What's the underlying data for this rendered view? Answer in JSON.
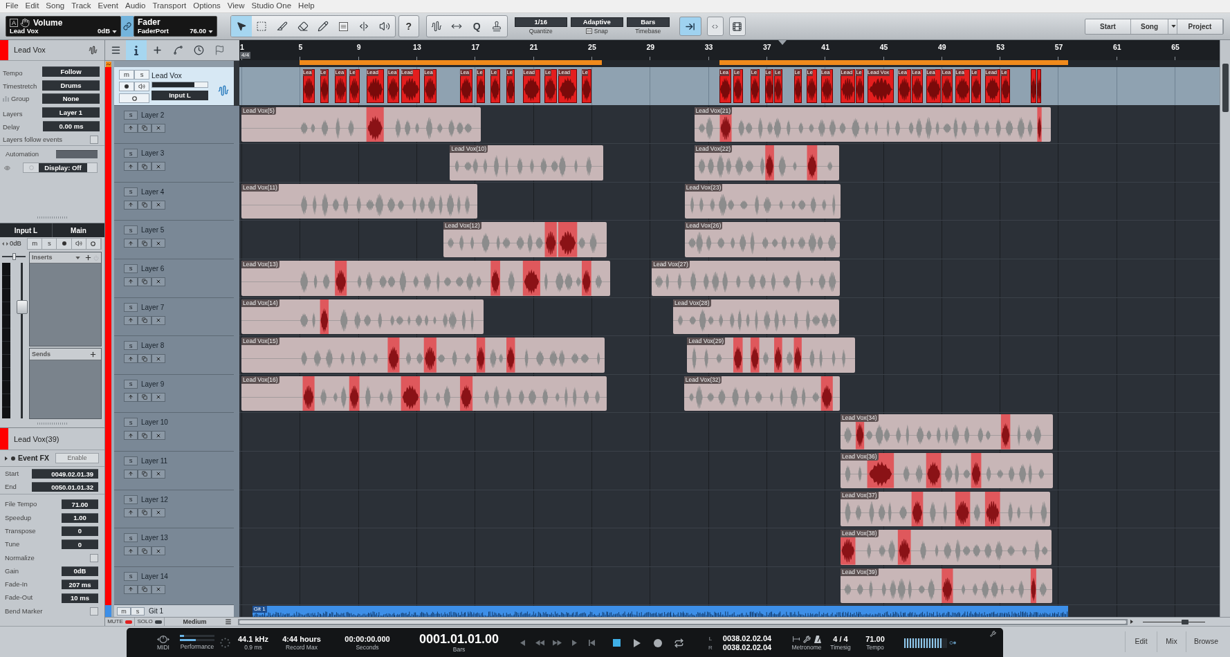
{
  "menu": [
    "File",
    "Edit",
    "Song",
    "Track",
    "Event",
    "Audio",
    "Transport",
    "Options",
    "View",
    "Studio One",
    "Help"
  ],
  "toolbar": {
    "volume": {
      "badge": "A",
      "title": "Volume",
      "track": "Lead Vox",
      "value": "0dB"
    },
    "link": {
      "on": true
    },
    "fader": {
      "title": "Fader",
      "device": "FaderPort",
      "value": "76.00"
    },
    "tools": [
      {
        "kind": "arrow",
        "selected": true
      },
      {
        "kind": "range",
        "selected": false
      },
      {
        "kind": "split",
        "selected": false
      },
      {
        "kind": "eraser",
        "selected": false
      },
      {
        "kind": "paint",
        "selected": false
      },
      {
        "kind": "mute",
        "selected": false
      },
      {
        "kind": "bend",
        "selected": false
      },
      {
        "kind": "listen",
        "selected": false
      }
    ],
    "help": "?",
    "edit_tools": [
      {
        "kind": "quantize"
      },
      {
        "kind": "stretch"
      },
      {
        "kind": "letter",
        "label": "Q"
      },
      {
        "kind": "stamp"
      }
    ],
    "quantize": {
      "value": "1/16",
      "label": "Quantize"
    },
    "snap": {
      "value": "Adaptive",
      "label": "Snap"
    },
    "timebase": {
      "value": "Bars",
      "label": "Timebase"
    },
    "toggles": [
      {
        "kind": "autoscroll",
        "on": true
      },
      {
        "kind": "follow",
        "on": false
      },
      {
        "kind": "video",
        "on": false
      }
    ],
    "pages": [
      {
        "label": "Start"
      },
      {
        "label": "Song",
        "kind": "dropdown"
      },
      {
        "label": "Project"
      }
    ]
  },
  "inspector": {
    "track": {
      "name": "Lead Vox",
      "color": "#ff0000"
    },
    "settings": [
      {
        "kind": "button",
        "label": "Tempo",
        "value": "Follow"
      },
      {
        "kind": "button",
        "label": "Timestretch",
        "value": "Drums"
      },
      {
        "kind": "group",
        "label": "Group",
        "value": "None"
      },
      {
        "kind": "button",
        "label": "Layers",
        "value": "Layer 1"
      },
      {
        "kind": "field",
        "label": "Delay",
        "value": "0.00 ms"
      },
      {
        "kind": "checkbox",
        "label": "Layers follow events",
        "checked": false
      }
    ],
    "automation": {
      "label": "Automation",
      "display": "Display: Off"
    },
    "channel": {
      "input": "Input L",
      "output": "Main",
      "volume": "0dB",
      "buttons": [
        {
          "kind": "letter",
          "label": "m"
        },
        {
          "kind": "letter",
          "label": "s"
        },
        {
          "kind": "record"
        },
        {
          "kind": "monitor"
        },
        {
          "kind": "ring"
        }
      ],
      "pan": {
        "level": 0.5
      },
      "fader": {
        "level": 0.75
      },
      "inserts": "Inserts",
      "sends": "Sends"
    },
    "event": {
      "name": "Lead Vox(39)",
      "color": "#ff0000",
      "fx": "Event FX",
      "enable": "Enable",
      "range": [
        {
          "label": "Start",
          "value": "0049.02.01.39"
        },
        {
          "label": "End",
          "value": "0050.01.01.32"
        }
      ],
      "properties": [
        {
          "kind": "field",
          "label": "File Tempo",
          "value": "71.00"
        },
        {
          "kind": "field",
          "label": "Speedup",
          "value": "1.00"
        },
        {
          "kind": "field",
          "label": "Transpose",
          "value": "0"
        },
        {
          "kind": "field",
          "label": "Tune",
          "value": "0"
        },
        {
          "kind": "checkbox",
          "label": "Normalize",
          "checked": false
        },
        {
          "kind": "field",
          "label": "Gain",
          "value": "0dB"
        },
        {
          "kind": "field",
          "label": "Fade-In",
          "value": "207 ms"
        },
        {
          "kind": "field",
          "label": "Fade-Out",
          "value": "10 ms"
        },
        {
          "kind": "checkbox",
          "label": "Bend Marker",
          "checked": false
        }
      ]
    }
  },
  "tracklist_tabs": [
    {
      "kind": "list",
      "selected": false
    },
    {
      "kind": "info",
      "selected": true
    },
    {
      "kind": "add",
      "selected": false
    },
    {
      "kind": "automation",
      "selected": false
    },
    {
      "kind": "tempo",
      "selected": false
    },
    {
      "kind": "marker",
      "selected": false
    }
  ],
  "arrangement": {
    "ruler": {
      "time_signature": "4/4",
      "bars": [
        "1",
        "5",
        "9",
        "13",
        "17",
        "21",
        "25",
        "29",
        "33",
        "37",
        "41",
        "45",
        "49",
        "53",
        "57",
        "61",
        "65"
      ]
    }
  },
  "tracks": [
    {
      "kind": "main",
      "name": "Lead Vox",
      "color": "#ff0000",
      "buttons": [
        {
          "kind": "letter",
          "label": "m"
        },
        {
          "kind": "letter",
          "label": "s"
        },
        {
          "kind": "record"
        },
        {
          "kind": "monitor"
        },
        {
          "kind": "ring"
        }
      ],
      "level": 0.76,
      "input": "Input L",
      "segments": [
        "Lea",
        "Le",
        "Lea",
        "Le",
        "Lead",
        "Lea",
        "Lead",
        "Lea",
        "Lea",
        "Le",
        "Le",
        "Le",
        "Lead",
        "Le",
        "Lead",
        "Le",
        "Lea",
        "Le",
        "Le",
        "Le",
        "Le",
        "Le",
        "Le",
        "Lea",
        "Lead",
        "Le",
        "Lead Vox",
        "Lea",
        "Lea",
        "Lea",
        "Lea",
        "Lea",
        "Le",
        "Lead",
        "Le"
      ]
    },
    {
      "kind": "layer",
      "name": "Layer 2",
      "solo": "s",
      "clips": [
        {
          "label": "Lead Vox(5)"
        },
        {
          "label": "Lead Vox(21)"
        }
      ]
    },
    {
      "kind": "layer",
      "name": "Layer 3",
      "solo": "s",
      "clips": [
        {
          "label": "Lead Vox(10)"
        },
        {
          "label": "Lead Vox(22)"
        }
      ]
    },
    {
      "kind": "layer",
      "name": "Layer 4",
      "solo": "s",
      "clips": [
        {
          "label": "Lead Vox(11)"
        },
        {
          "label": "Lead Vox(23)"
        }
      ]
    },
    {
      "kind": "layer",
      "name": "Layer 5",
      "solo": "s",
      "clips": [
        {
          "label": "Lead Vox(12)"
        },
        {
          "label": "Lead Vox(26)"
        }
      ]
    },
    {
      "kind": "layer",
      "name": "Layer 6",
      "solo": "s",
      "clips": [
        {
          "label": "Lead Vox(13)"
        },
        {
          "label": "Lead Vox(27)"
        }
      ]
    },
    {
      "kind": "layer",
      "name": "Layer 7",
      "solo": "s",
      "clips": [
        {
          "label": "Lead Vox(14)"
        },
        {
          "label": "Lead Vox(28)"
        }
      ]
    },
    {
      "kind": "layer",
      "name": "Layer 8",
      "solo": "s",
      "clips": [
        {
          "label": "Lead Vox(15)"
        },
        {
          "label": "Lead Vox(29)"
        }
      ]
    },
    {
      "kind": "layer",
      "name": "Layer 9",
      "solo": "s",
      "clips": [
        {
          "label": "Lead Vox(16)"
        },
        {
          "label": "Lead Vox(32)"
        }
      ]
    },
    {
      "kind": "layer",
      "name": "Layer 10",
      "solo": "s",
      "clips": [
        {
          "label": "Lead Vox(34)"
        }
      ]
    },
    {
      "kind": "layer",
      "name": "Layer 11",
      "solo": "s",
      "clips": [
        {
          "label": "Lead Vox(36)"
        }
      ]
    },
    {
      "kind": "layer",
      "name": "Layer 12",
      "solo": "s",
      "clips": [
        {
          "label": "Lead Vox(37)"
        }
      ]
    },
    {
      "kind": "layer",
      "name": "Layer 13",
      "solo": "s",
      "clips": [
        {
          "label": "Lead Vox(38)"
        }
      ]
    },
    {
      "kind": "layer",
      "name": "Layer 14",
      "solo": "s",
      "clips": [
        {
          "label": "Lead Vox(39)"
        }
      ]
    }
  ],
  "git_track": {
    "name": "Git 1",
    "color": "#3d8fe8",
    "buttons": [
      "m",
      "s"
    ],
    "clip": {
      "label": "Git 1"
    }
  },
  "footer": {
    "mute": {
      "label": "MUTE",
      "on": true
    },
    "solo": {
      "label": "SOLO",
      "on": false
    },
    "size": "Medium",
    "zoom": {
      "level": 0.7
    }
  },
  "transport": {
    "midi": "MIDI",
    "performance": {
      "label": "Performance",
      "meters": [
        {
          "level": 0.12
        },
        {
          "level": 0.45
        }
      ]
    },
    "sample_rate": "44.1 kHz",
    "latency": "0.9 ms",
    "record_max": {
      "value": "4:44 hours",
      "label": "Record Max"
    },
    "seconds": {
      "value": "00:00:00.000",
      "label": "Seconds"
    },
    "bars": {
      "value": "0001.01.01.00",
      "label": "Bars"
    },
    "buttons": [
      {
        "kind": "prev",
        "on": false
      },
      {
        "kind": "rewind",
        "on": false
      },
      {
        "kind": "forward",
        "on": false
      },
      {
        "kind": "next",
        "on": false
      },
      {
        "kind": "to_start",
        "on": false
      },
      {
        "kind": "stop",
        "on": true
      },
      {
        "kind": "play",
        "on": false
      },
      {
        "kind": "record",
        "on": false
      },
      {
        "kind": "loop",
        "on": false
      }
    ],
    "loop": [
      {
        "label": "L",
        "value": "0038.02.02.04"
      },
      {
        "label": "R",
        "value": "0038.02.02.04"
      }
    ],
    "metronome": "Metronome",
    "timesig": {
      "value": "4 / 4",
      "label": "Timesig"
    },
    "tempo": {
      "value": "71.00",
      "label": "Tempo"
    },
    "meter": {
      "level": 0.9
    }
  },
  "bottom_pages": [
    "Edit",
    "Mix",
    "Browse"
  ]
}
